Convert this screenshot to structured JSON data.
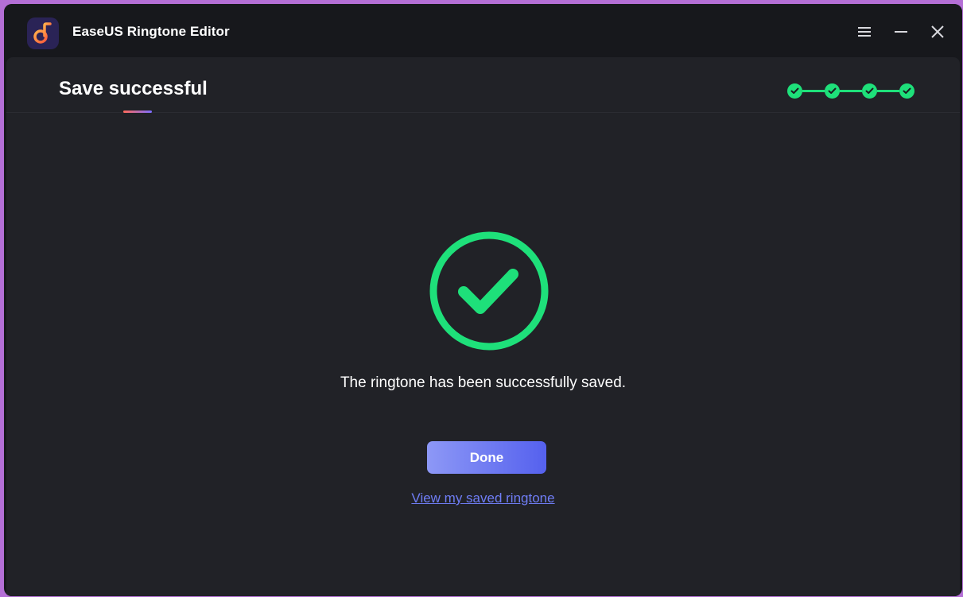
{
  "window": {
    "title": "EaseUS Ringtone Editor",
    "icons": {
      "logo": "music-note-logo-icon",
      "menu": "hamburger-menu-icon",
      "minimize": "minimize-icon",
      "close": "close-icon"
    }
  },
  "header": {
    "title": "Save successful",
    "steps": [
      {
        "status": "complete"
      },
      {
        "status": "complete"
      },
      {
        "status": "complete"
      },
      {
        "status": "complete"
      }
    ]
  },
  "main": {
    "status_icon": "success-check-icon",
    "message": "The ringtone has been successfully saved.",
    "done_button": "Done",
    "view_link": "View my saved ringtone"
  },
  "colors": {
    "accent_green": "#1ee07a",
    "button_gradient_start": "#8d98f6",
    "button_gradient_end": "#5561ee",
    "link": "#6f7df5",
    "panel_bg": "#212227",
    "window_bg": "#17181c"
  }
}
